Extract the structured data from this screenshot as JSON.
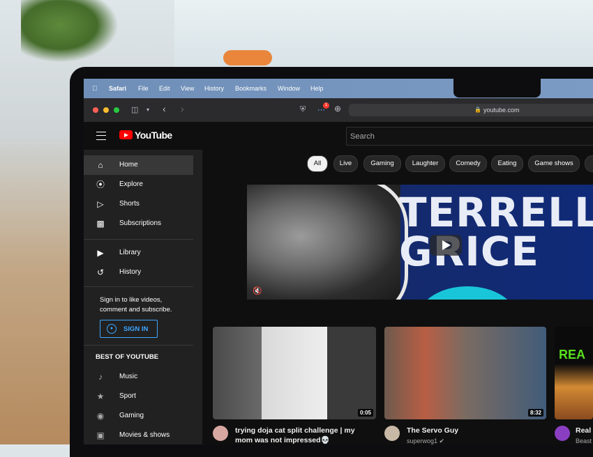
{
  "menubar": {
    "items": [
      "Safari",
      "File",
      "Edit",
      "View",
      "History",
      "Bookmarks",
      "Window",
      "Help"
    ]
  },
  "browser": {
    "url": "youtube.com",
    "notification_count": "1"
  },
  "youtube": {
    "logo_text": "YouTube",
    "search_placeholder": "Search",
    "sidebar": {
      "primary": [
        {
          "label": "Home",
          "icon": "home-icon",
          "active": true
        },
        {
          "label": "Explore",
          "icon": "compass-icon"
        },
        {
          "label": "Shorts",
          "icon": "shorts-icon"
        },
        {
          "label": "Subscriptions",
          "icon": "subscriptions-icon"
        }
      ],
      "secondary": [
        {
          "label": "Library",
          "icon": "library-icon"
        },
        {
          "label": "History",
          "icon": "history-icon"
        }
      ],
      "signin_prompt": "Sign in to like videos, comment and subscribe.",
      "signin_button": "SIGN IN",
      "best_of_title": "BEST OF YOUTUBE",
      "best_of": [
        {
          "label": "Music",
          "icon": "music-icon"
        },
        {
          "label": "Sport",
          "icon": "trophy-icon"
        },
        {
          "label": "Gaming",
          "icon": "gaming-icon"
        },
        {
          "label": "Movies & shows",
          "icon": "movies-icon"
        }
      ]
    },
    "chips": [
      "All",
      "Live",
      "Gaming",
      "Laughter",
      "Comedy",
      "Eating",
      "Game shows"
    ],
    "hero": {
      "title_line1": "TERRELL",
      "title_line2": "GRICE"
    },
    "videos": [
      {
        "title": "trying doja cat split challenge | my mom was not impressed💀",
        "channel": "",
        "duration": "0:05"
      },
      {
        "title": "The Servo Guy",
        "channel": "superwog1",
        "duration": "8:32"
      },
      {
        "title": "Real V",
        "channel": "Beast",
        "duration": ""
      }
    ],
    "colors": {
      "brand_red": "#ff0000",
      "link_blue": "#3ea6ff",
      "background": "#0f0f0f",
      "sidebar_bg": "#212121"
    }
  }
}
